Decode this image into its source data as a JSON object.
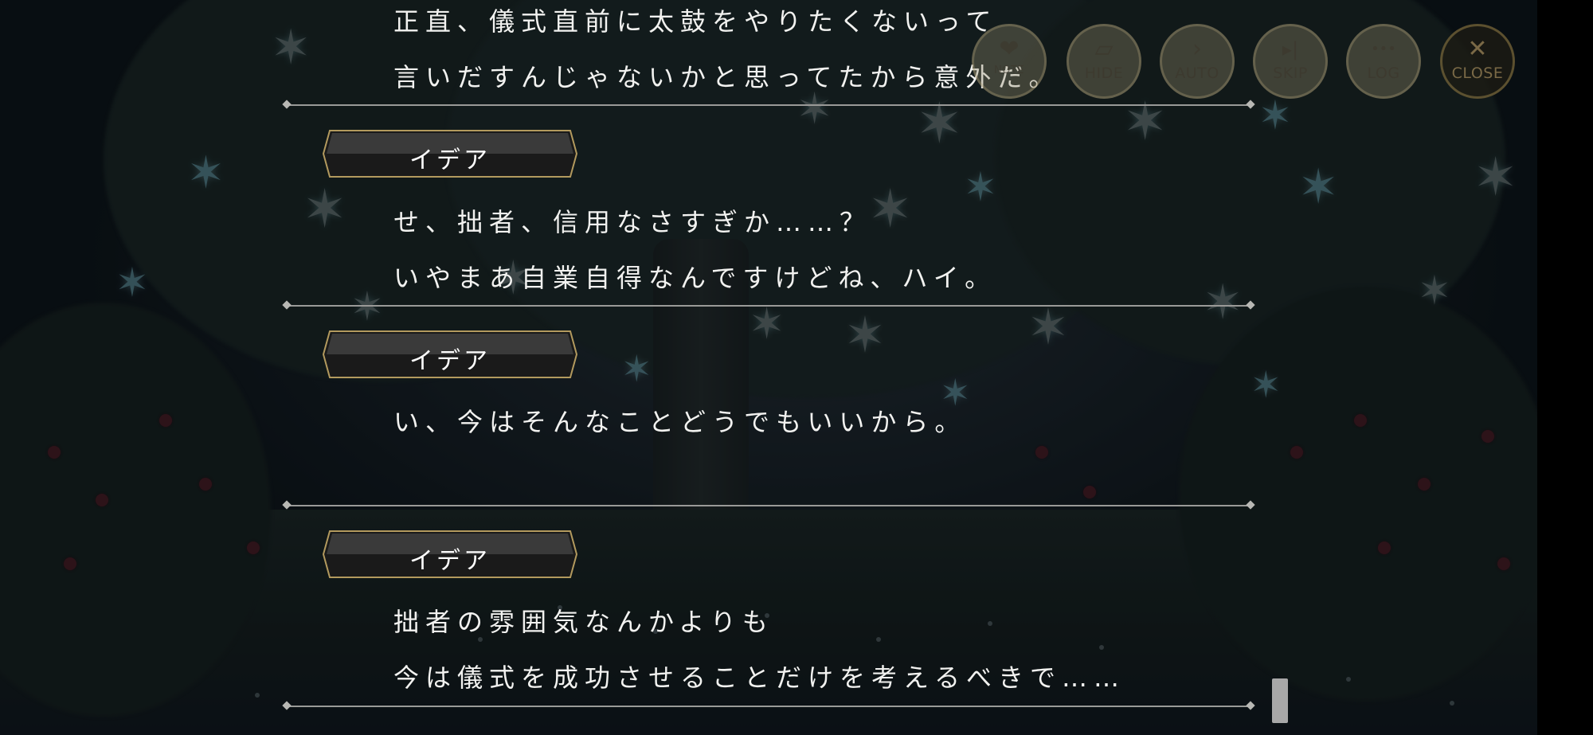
{
  "toolbar": {
    "buttons": [
      {
        "id": "favorite",
        "label": "NOTE",
        "icon": "heart-icon",
        "glyph": "❤"
      },
      {
        "id": "hide",
        "label": "HIDE",
        "icon": "hide-icon",
        "glyph": "▱"
      },
      {
        "id": "auto",
        "label": "AUTO",
        "icon": "chevron-right-icon",
        "glyph": "›"
      },
      {
        "id": "skip",
        "label": "SKIP",
        "icon": "skip-icon",
        "glyph": "▸|"
      },
      {
        "id": "log",
        "label": "LOG",
        "icon": "log-icon",
        "glyph": "•••"
      },
      {
        "id": "close",
        "label": "CLOSE",
        "icon": "close-icon",
        "glyph": "✕"
      }
    ]
  },
  "log": {
    "entries": [
      {
        "speaker": "",
        "lines": [
          "正直、儀式直前に太鼓をやりたくないって",
          "言いだすんじゃないかと思ってたから意外だ。"
        ]
      },
      {
        "speaker": "イデア",
        "lines": [
          "せ、拙者、信用なさすぎか……？",
          "いやまあ自業自得なんですけどね、ハイ。"
        ]
      },
      {
        "speaker": "イデア",
        "lines": [
          "い、今はそんなことどうでもいいから。"
        ]
      },
      {
        "speaker": "イデア",
        "lines": [
          "拙者の雰囲気なんかよりも",
          "今は儀式を成功させることだけを考えるべきで……"
        ]
      }
    ]
  },
  "colors": {
    "nameplate_border": "#b39a5e",
    "nameplate_fill": "#1a1a1a",
    "text": "#f2f2f0",
    "separator": "#9a9a98"
  }
}
